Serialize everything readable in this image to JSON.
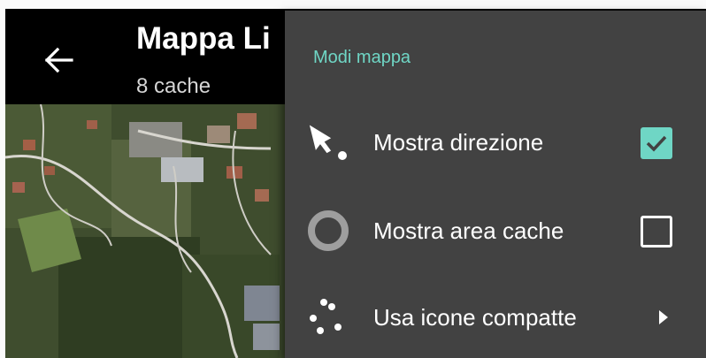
{
  "appbar": {
    "title": "Mappa Li",
    "subtitle": "8 cache",
    "back_icon": "arrow-back-icon"
  },
  "menu": {
    "header": "Modi mappa",
    "items": [
      {
        "label": "Mostra direzione",
        "icon": "direction-icon",
        "control": "checkbox",
        "checked": true
      },
      {
        "label": "Mostra area cache",
        "icon": "cache-area-ring-icon",
        "control": "checkbox",
        "checked": false
      },
      {
        "label": "Usa icone compatte",
        "icon": "compact-dots-icon",
        "control": "submenu-arrow"
      }
    ]
  },
  "colors": {
    "accent": "#6fd6c5",
    "menu_bg": "#424242",
    "appbar_bg": "#000000"
  }
}
